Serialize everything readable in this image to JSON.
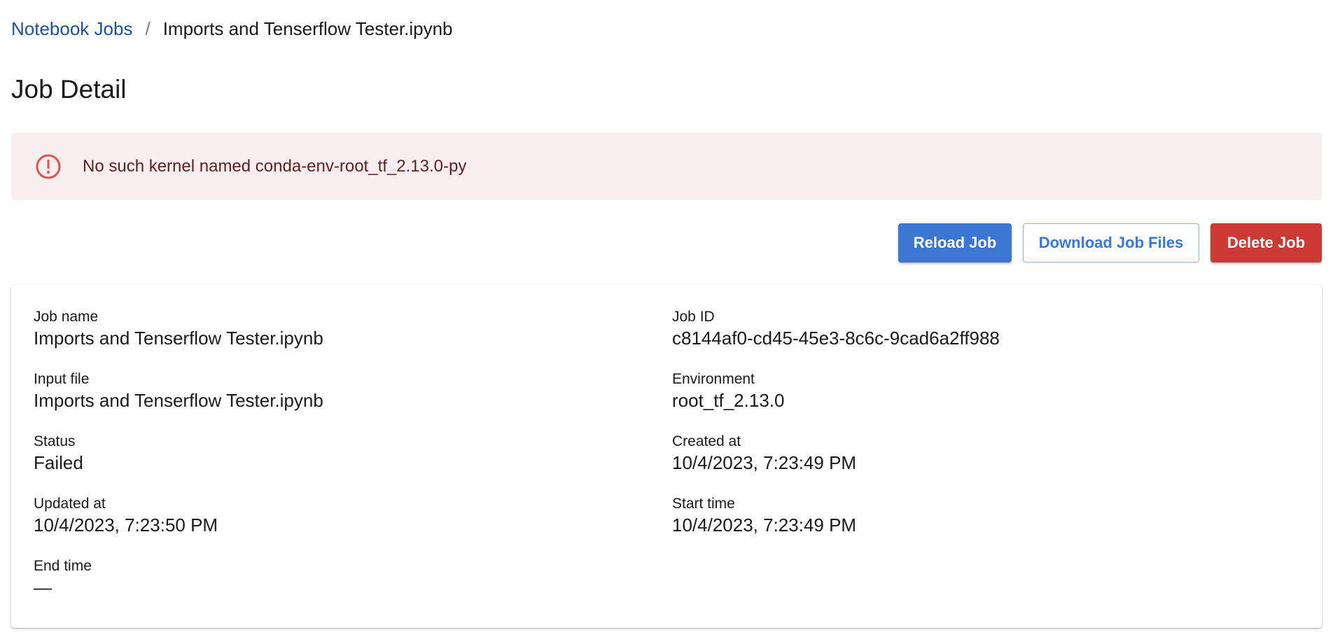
{
  "breadcrumb": {
    "parent": "Notebook Jobs",
    "separator": "/",
    "current": "Imports and Tenserflow Tester.ipynb"
  },
  "page_title": "Job Detail",
  "alert": {
    "icon": "error-outline-icon",
    "message": "No such kernel named conda-env-root_tf_2.13.0-py",
    "color": "#d9534f"
  },
  "actions": {
    "reload": "Reload Job",
    "download": "Download Job Files",
    "delete": "Delete Job"
  },
  "colors": {
    "primary": "#3a76d2",
    "danger": "#c93a32",
    "link": "#1d4f9c",
    "alert_bg": "#f9eeee"
  },
  "details": {
    "job_name": {
      "label": "Job name",
      "value": "Imports and Tenserflow Tester.ipynb"
    },
    "job_id": {
      "label": "Job ID",
      "value": "c8144af0-cd45-45e3-8c6c-9cad6a2ff988"
    },
    "input_file": {
      "label": "Input file",
      "value": "Imports and Tenserflow Tester.ipynb"
    },
    "environment": {
      "label": "Environment",
      "value": "root_tf_2.13.0"
    },
    "status": {
      "label": "Status",
      "value": "Failed"
    },
    "created_at": {
      "label": "Created at",
      "value": "10/4/2023, 7:23:49 PM"
    },
    "updated_at": {
      "label": "Updated at",
      "value": "10/4/2023, 7:23:50 PM"
    },
    "start_time": {
      "label": "Start time",
      "value": "10/4/2023, 7:23:49 PM"
    },
    "end_time": {
      "label": "End time",
      "value": "—"
    }
  }
}
